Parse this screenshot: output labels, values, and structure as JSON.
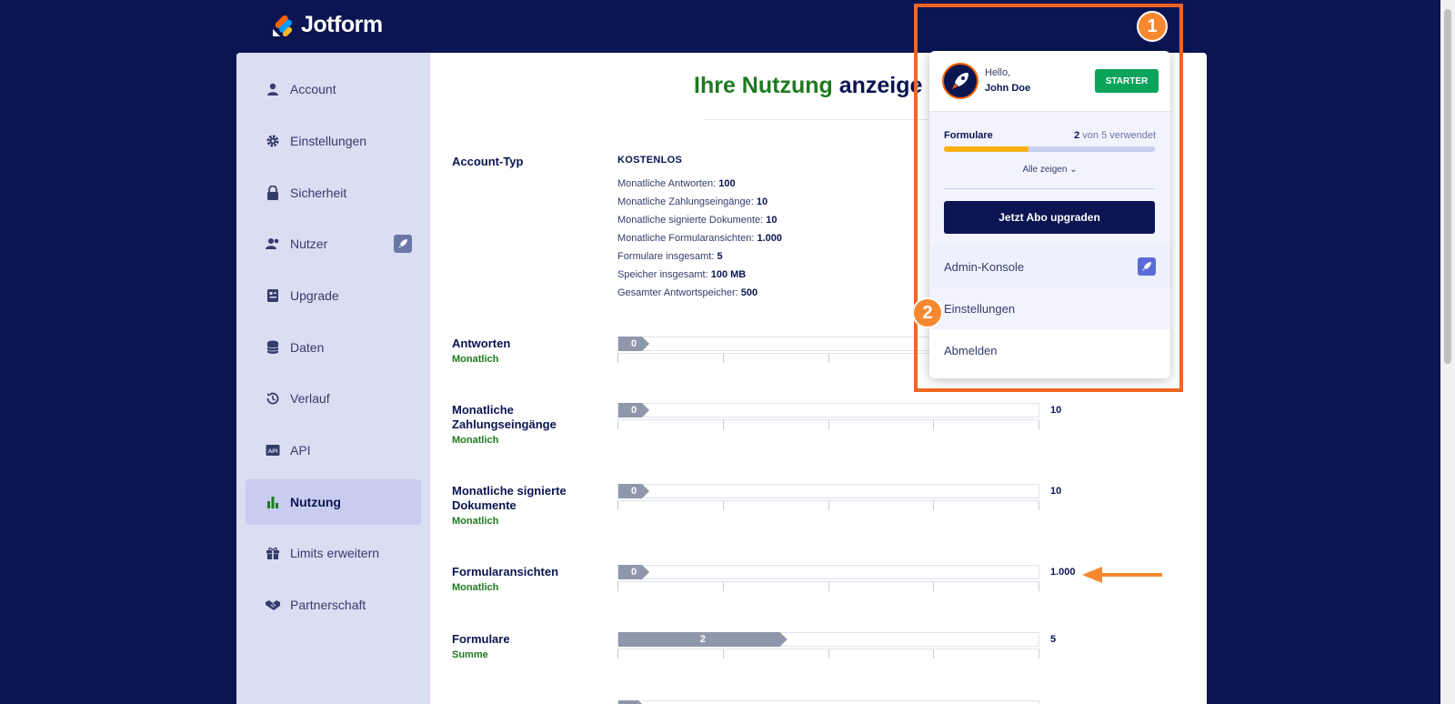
{
  "brand": {
    "name": "Jotform"
  },
  "sidebar": {
    "items": [
      {
        "label": "Account",
        "icon": "user-icon"
      },
      {
        "label": "Einstellungen",
        "icon": "gear-icon"
      },
      {
        "label": "Sicherheit",
        "icon": "lock-icon"
      },
      {
        "label": "Nutzer",
        "icon": "users-icon"
      },
      {
        "label": "Upgrade",
        "icon": "upgrade-icon"
      },
      {
        "label": "Daten",
        "icon": "database-icon"
      },
      {
        "label": "Verlauf",
        "icon": "history-icon"
      },
      {
        "label": "API",
        "icon": "api-icon"
      },
      {
        "label": "Nutzung",
        "icon": "bar-chart-icon",
        "active": true
      },
      {
        "label": "Limits erweitern",
        "icon": "gift-icon"
      },
      {
        "label": "Partnerschaft",
        "icon": "handshake-icon"
      }
    ]
  },
  "main": {
    "title_green": "Ihre Nutzung",
    "title_rest": "anzeige",
    "account": {
      "label": "Account-Typ",
      "type": "KOSTENLOS",
      "details": [
        {
          "k": "Monatliche Antworten:",
          "v": "100"
        },
        {
          "k": "Monatliche Zahlungseingänge:",
          "v": "10"
        },
        {
          "k": "Monatliche signierte Dokumente:",
          "v": "10"
        },
        {
          "k": "Monatliche Formularansichten:",
          "v": "1.000"
        },
        {
          "k": "Formulare insgesamt:",
          "v": "5"
        },
        {
          "k": "Speicher insgesamt:",
          "v": "100 MB"
        },
        {
          "k": "Gesamter Antwortspeicher:",
          "v": "500"
        }
      ]
    },
    "usage": [
      {
        "label": "Antworten",
        "sub": "Monatlich",
        "value": "0",
        "max": "",
        "fraction": 0
      },
      {
        "label": "Monatliche Zahlungseingänge",
        "sub": "Monatlich",
        "value": "0",
        "max": "10",
        "fraction": 0
      },
      {
        "label": "Monatliche signierte Dokumente",
        "sub": "Monatlich",
        "value": "0",
        "max": "10",
        "fraction": 0
      },
      {
        "label": "Formularansichten",
        "sub": "Monatlich",
        "value": "0",
        "max": "1.000",
        "fraction": 0
      },
      {
        "label": "Formulare",
        "sub": "Summe",
        "value": "2",
        "max": "5",
        "fraction": 0.4
      },
      {
        "label": "",
        "sub": "",
        "value": "",
        "max": "",
        "fraction": 0
      }
    ]
  },
  "popup": {
    "greeting": "Hello,",
    "user_name": "John Doe",
    "plan_badge": "STARTER",
    "forms_label": "Formulare",
    "forms_used": "2",
    "forms_of": "von 5 verwendet",
    "forms_fraction": 0.4,
    "show_all": "Alle zeigen",
    "upgrade_button": "Jetzt Abo upgraden",
    "menu": [
      {
        "label": "Admin-Konsole"
      },
      {
        "label": "Einstellungen"
      },
      {
        "label": "Abmelden"
      }
    ]
  },
  "annotations": {
    "badge1": "1",
    "badge2": "2"
  },
  "colors": {
    "navy": "#0a1551",
    "orange": "#f26522",
    "green": "#1f7a1f",
    "starter": "#0aa35a"
  }
}
